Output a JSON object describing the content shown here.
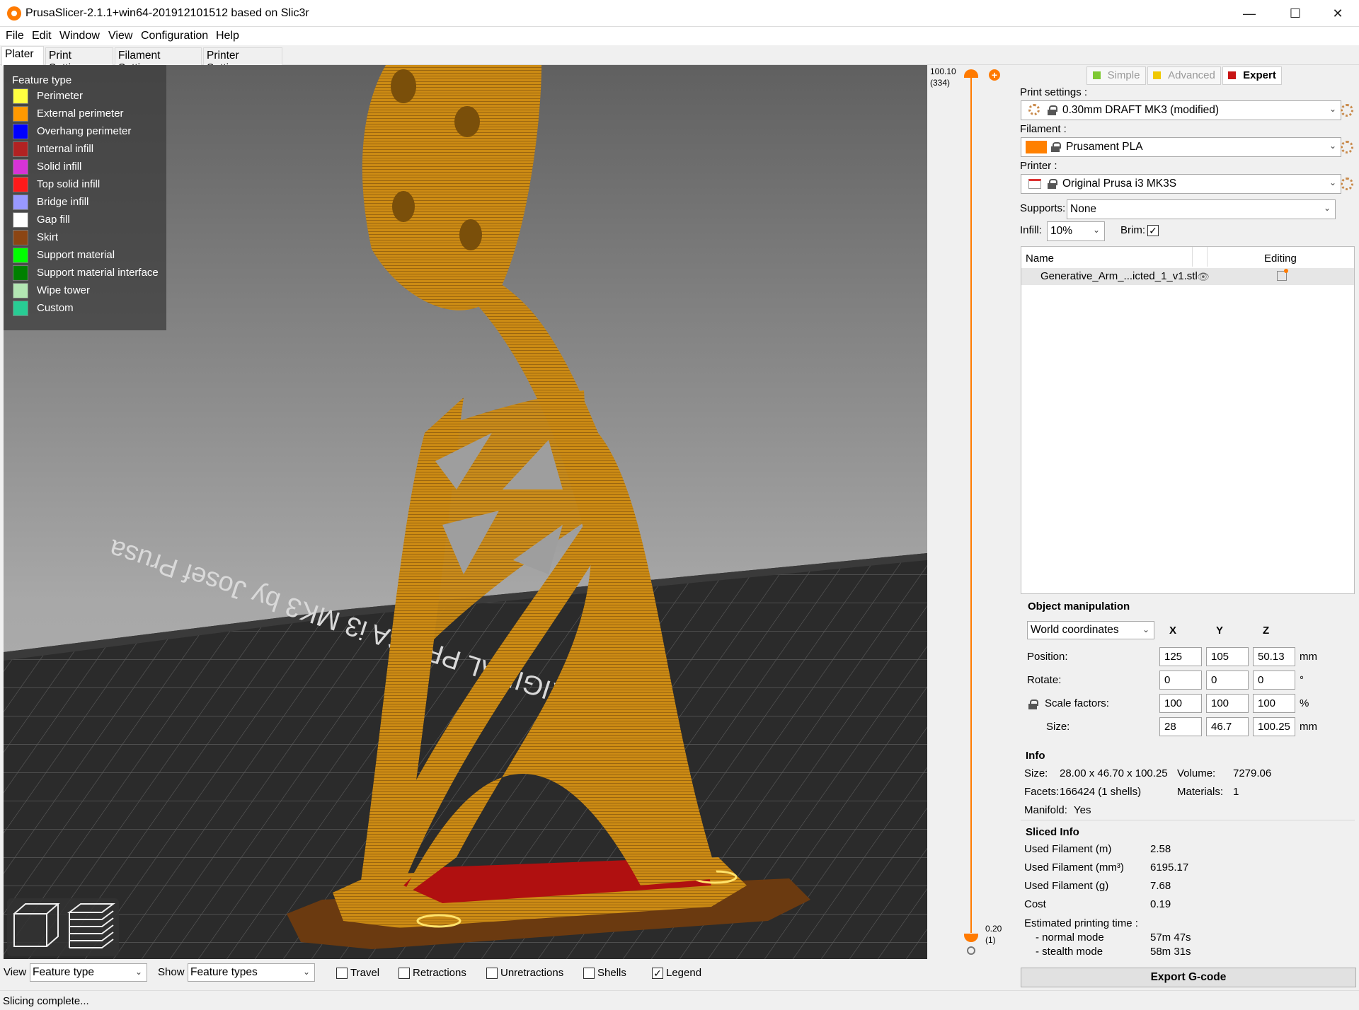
{
  "window": {
    "title": "PrusaSlicer-2.1.1+win64-201912101512 based on Slic3r",
    "minimize": "—",
    "maximize": "☐",
    "close": "✕"
  },
  "menu": [
    "File",
    "Edit",
    "Window",
    "View",
    "Configuration",
    "Help"
  ],
  "tabs": [
    "Plater",
    "Print Settings",
    "Filament Settings",
    "Printer Settings"
  ],
  "legend": {
    "title": "Feature type",
    "items": [
      {
        "label": "Perimeter",
        "color": "#ffff40"
      },
      {
        "label": "External perimeter",
        "color": "#ff9900"
      },
      {
        "label": "Overhang perimeter",
        "color": "#0000ff"
      },
      {
        "label": "Internal infill",
        "color": "#b22222"
      },
      {
        "label": "Solid infill",
        "color": "#d633d6"
      },
      {
        "label": "Top solid infill",
        "color": "#ff1a1a"
      },
      {
        "label": "Bridge infill",
        "color": "#9999ff"
      },
      {
        "label": "Gap fill",
        "color": "#ffffff"
      },
      {
        "label": "Skirt",
        "color": "#8b4513"
      },
      {
        "label": "Support material",
        "color": "#00ff00"
      },
      {
        "label": "Support material interface",
        "color": "#008000"
      },
      {
        "label": "Wipe tower",
        "color": "#b3e6b3"
      },
      {
        "label": "Custom",
        "color": "#28cc94"
      }
    ]
  },
  "bed_text": "ORIGINAL PRUSA i3 MK3 by Josef Prusa",
  "layer_slider": {
    "top_value": "100.10",
    "top_layer": "(334)",
    "bottom_value": "0.20",
    "bottom_layer": "(1)",
    "accent": "#ff7a00"
  },
  "modes": [
    {
      "label": "Simple",
      "color": "#7ec832",
      "active": false
    },
    {
      "label": "Advanced",
      "color": "#f0c800",
      "active": false
    },
    {
      "label": "Expert",
      "color": "#c81414",
      "active": true
    }
  ],
  "print_settings": {
    "label": "Print settings :",
    "value": "0.30mm DRAFT MK3 (modified)"
  },
  "filament": {
    "label": "Filament :",
    "value": "Prusament PLA",
    "color": "#ff8000"
  },
  "printer": {
    "label": "Printer :",
    "value": "Original Prusa i3 MK3S"
  },
  "supports": {
    "label": "Supports:",
    "value": "None"
  },
  "infill": {
    "label": "Infill:",
    "value": "10%"
  },
  "brim": {
    "label": "Brim:",
    "checked": "✓"
  },
  "object_list": {
    "col_name": "Name",
    "col_editing": "Editing",
    "rows": [
      {
        "name": "Generative_Arm_...icted_1_v1.stl"
      }
    ]
  },
  "object_manipulation": {
    "title": "Object manipulation",
    "coord_mode": "World coordinates",
    "axes": [
      "X",
      "Y",
      "Z"
    ],
    "rows": [
      {
        "label": "Position:",
        "values": [
          "125",
          "105",
          "50.13"
        ],
        "unit": "mm"
      },
      {
        "label": "Rotate:",
        "values": [
          "0",
          "0",
          "0"
        ],
        "unit": "°"
      },
      {
        "label": "Scale factors:",
        "values": [
          "100",
          "100",
          "100"
        ],
        "unit": "%"
      },
      {
        "label": "Size:",
        "values": [
          "28",
          "46.7",
          "100.25"
        ],
        "unit": "mm"
      }
    ]
  },
  "info": {
    "title": "Info",
    "size_label": "Size:",
    "size": "28.00 x 46.70 x 100.25",
    "volume_label": "Volume:",
    "volume": "7279.06",
    "facets_label": "Facets:",
    "facets": "166424 (1 shells)",
    "materials_label": "Materials:",
    "materials": "1",
    "manifold_label": "Manifold:",
    "manifold": "Yes"
  },
  "sliced_info": {
    "title": "Sliced Info",
    "rows": [
      {
        "label": "Used Filament (m)",
        "value": "2.58"
      },
      {
        "label": "Used Filament (mm³)",
        "value": "6195.17"
      },
      {
        "label": "Used Filament (g)",
        "value": "7.68"
      },
      {
        "label": "Cost",
        "value": "0.19"
      }
    ],
    "time_label": "Estimated printing time :",
    "normal_label": "- normal mode",
    "normal": "57m 47s",
    "stealth_label": "- stealth mode",
    "stealth": "58m 31s"
  },
  "export_button": "Export G-code",
  "bottom": {
    "view_label": "View",
    "view_value": "Feature type",
    "show_label": "Show",
    "show_value": "Feature types",
    "checks": [
      {
        "label": "Travel",
        "checked": ""
      },
      {
        "label": "Retractions",
        "checked": ""
      },
      {
        "label": "Unretractions",
        "checked": ""
      },
      {
        "label": "Shells",
        "checked": ""
      },
      {
        "label": "Legend",
        "checked": "✓"
      }
    ]
  },
  "status": "Slicing complete..."
}
